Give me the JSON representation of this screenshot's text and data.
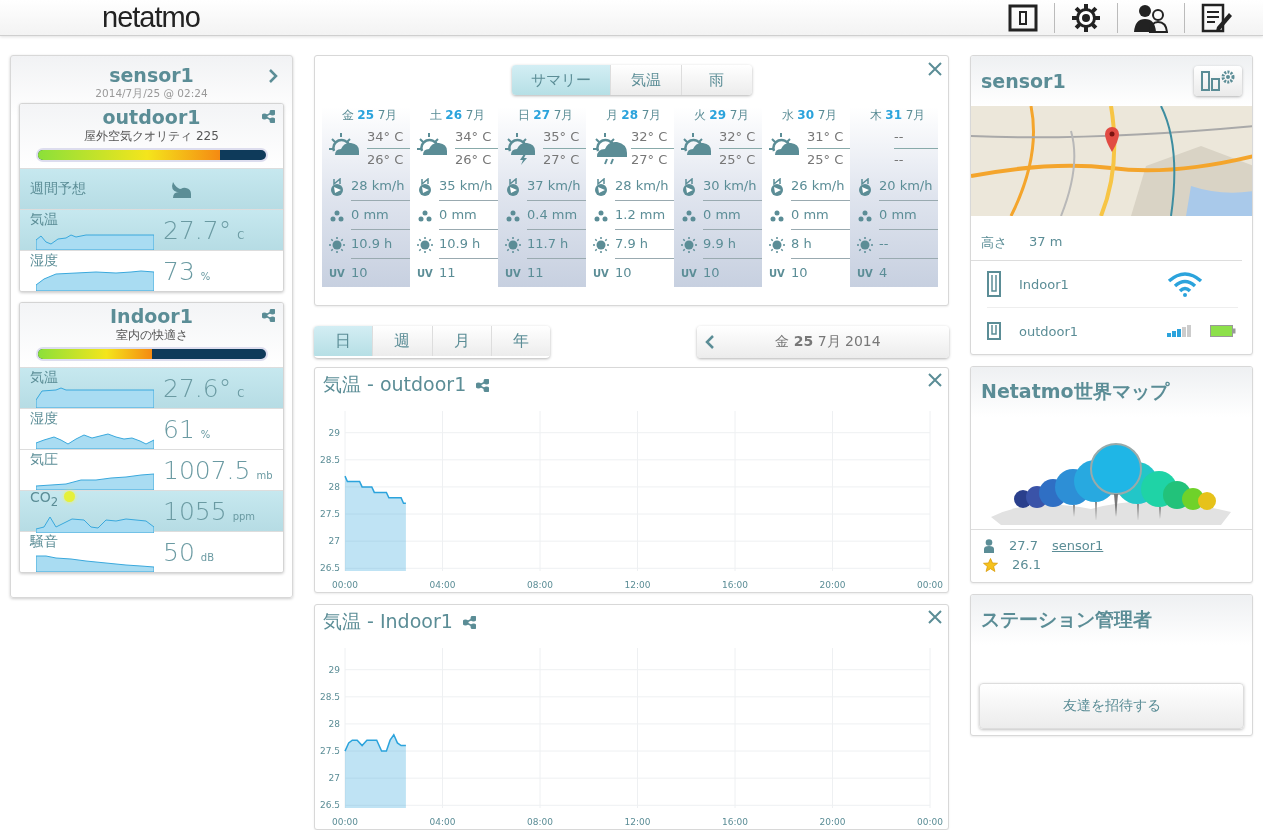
{
  "header": {
    "logo": "net**atmo**"
  },
  "station": {
    "title": "sensor1",
    "updated": "2014/7月/25 @ 02:24",
    "modules": [
      {
        "name": "outdoor1",
        "quality": "屋外空気クオリティ 225",
        "level": 0.8,
        "rows": [
          {
            "kind": "forecast",
            "label": "週間予想",
            "highlighted": true
          },
          {
            "kind": "measure",
            "label": "気温",
            "value": "27.7°",
            "unit": "C",
            "highlighted": true,
            "alert": false
          },
          {
            "kind": "measure",
            "label": "湿度",
            "value": "73",
            "unit": "%",
            "highlighted": false,
            "alert": false
          }
        ]
      },
      {
        "name": "Indoor1",
        "quality": "室内の快適さ",
        "level": 0.5,
        "rows": [
          {
            "kind": "measure",
            "label": "気温",
            "value": "27.6°",
            "unit": "C",
            "highlighted": true,
            "alert": false
          },
          {
            "kind": "measure",
            "label": "湿度",
            "value": "61",
            "unit": "%",
            "highlighted": false,
            "alert": false
          },
          {
            "kind": "measure",
            "label": "気圧",
            "value": "1007.5",
            "unit": "mb",
            "highlighted": false,
            "alert": false
          },
          {
            "kind": "measure",
            "label": "CO$_{2}$",
            "value": "1055",
            "unit": "ppm",
            "highlighted": true,
            "alert": true
          },
          {
            "kind": "measure",
            "label": "騒音",
            "value": "50",
            "unit": "dB",
            "highlighted": false,
            "alert": false
          }
        ]
      }
    ]
  },
  "forecast": {
    "tabs": [
      {
        "label": "サマリー",
        "selected": true
      },
      {
        "label": "気温",
        "selected": false
      },
      {
        "label": "雨",
        "selected": false
      }
    ],
    "days": [
      {
        "weekday": "金",
        "date": "25",
        "month": "7月",
        "kind": "sun-cloud",
        "high": "34° C",
        "low": "26° C",
        "wind": "28 km/h",
        "rain": "0 mm",
        "sun": "10.9 h",
        "uv_label": "UV",
        "uv": "10"
      },
      {
        "weekday": "土",
        "date": "26",
        "month": "7月",
        "kind": "sun-cloud",
        "high": "34° C",
        "low": "26° C",
        "wind": "35 km/h",
        "rain": "0 mm",
        "sun": "10.9 h",
        "uv_label": "UV",
        "uv": "11"
      },
      {
        "weekday": "日",
        "date": "27",
        "month": "7月",
        "kind": "storm",
        "high": "35° C",
        "low": "27° C",
        "wind": "37 km/h",
        "rain": "0.4 mm",
        "sun": "11.7 h",
        "uv_label": "UV",
        "uv": "11"
      },
      {
        "weekday": "月",
        "date": "28",
        "month": "7月",
        "kind": "rain",
        "high": "32° C",
        "low": "27° C",
        "wind": "28 km/h",
        "rain": "1.2 mm",
        "sun": "7.9 h",
        "uv_label": "UV",
        "uv": "10"
      },
      {
        "weekday": "火",
        "date": "29",
        "month": "7月",
        "kind": "sun-cloud",
        "high": "32° C",
        "low": "25° C",
        "wind": "30 km/h",
        "rain": "0 mm",
        "sun": "9.9 h",
        "uv_label": "UV",
        "uv": "10"
      },
      {
        "weekday": "水",
        "date": "30",
        "month": "7月",
        "kind": "sun-cloud",
        "high": "31° C",
        "low": "25° C",
        "wind": "26 km/h",
        "rain": "0 mm",
        "sun": "8 h",
        "uv_label": "UV",
        "uv": "10"
      },
      {
        "weekday": "木",
        "date": "31",
        "month": "7月",
        "kind": "none",
        "high": "--",
        "low": "--",
        "wind": "20 km/h",
        "rain": "0 mm",
        "sun": "--",
        "uv_label": "UV",
        "uv": "4"
      }
    ]
  },
  "period": {
    "tabs": [
      {
        "label": "日",
        "selected": true
      },
      {
        "label": "週",
        "selected": false
      },
      {
        "label": "月",
        "selected": false
      },
      {
        "label": "年",
        "selected": false
      }
    ],
    "date": "金 **25** 7月 2014"
  },
  "charts": [
    {
      "title": "気温 - outdoor1",
      "chart_data": {
        "type": "area",
        "x": [
          0,
          0.1,
          0.6,
          0.7,
          1.1,
          1.2,
          1.7,
          1.8,
          2.3,
          2.4,
          2.5
        ],
        "series": [
          {
            "color": "#2ba3dc",
            "values": [
              28.2,
              28.1,
              28.1,
              28.0,
              28.0,
              27.9,
              27.9,
              27.8,
              27.8,
              27.7,
              27.7
            ]
          }
        ],
        "xlim": [
          0,
          24
        ],
        "ylim": [
          26.45,
          29.4
        ],
        "xticks": [
          {
            "value": 0,
            "label": "00:00"
          },
          {
            "value": 4,
            "label": "04:00"
          },
          {
            "value": 8,
            "label": "08:00"
          },
          {
            "value": 12,
            "label": "12:00"
          },
          {
            "value": 16,
            "label": "16:00"
          },
          {
            "value": 20,
            "label": "20:00"
          },
          {
            "value": 24,
            "label": "00:00"
          }
        ],
        "yticks": [
          26.5,
          27,
          27.5,
          28,
          28.5,
          29
        ],
        "grid": true
      }
    },
    {
      "title": "気温 - Indoor1",
      "chart_data": {
        "type": "area",
        "x": [
          0,
          0.15,
          0.3,
          0.5,
          0.7,
          0.9,
          1.1,
          1.3,
          1.5,
          1.7,
          1.85,
          2.0,
          2.15,
          2.3,
          2.5
        ],
        "series": [
          {
            "color": "#2ba3dc",
            "values": [
              27.5,
              27.65,
              27.7,
              27.7,
              27.6,
              27.7,
              27.7,
              27.7,
              27.5,
              27.5,
              27.7,
              27.8,
              27.65,
              27.6,
              27.6
            ]
          }
        ],
        "xlim": [
          0,
          24
        ],
        "ylim": [
          26.45,
          29.4
        ],
        "xticks": [
          {
            "value": 0,
            "label": "00:00"
          },
          {
            "value": 4,
            "label": "04:00"
          },
          {
            "value": 8,
            "label": "08:00"
          },
          {
            "value": 12,
            "label": "12:00"
          },
          {
            "value": 16,
            "label": "16:00"
          },
          {
            "value": 20,
            "label": "20:00"
          },
          {
            "value": 24,
            "label": "00:00"
          }
        ],
        "yticks": [
          26.5,
          27,
          27.5,
          28,
          28.5,
          29
        ],
        "grid": true
      }
    }
  ],
  "device": {
    "title": "sensor1",
    "altitude_label": "高さ",
    "altitude": "37 m",
    "modules": [
      {
        "name": "Indoor1",
        "kind": "indoor"
      },
      {
        "name": "outdoor1",
        "kind": "outdoor"
      }
    ]
  },
  "weathermap": {
    "title": "Netatmo世界マップ",
    "rows": [
      {
        "kind": "person",
        "value": "27.7",
        "link": "sensor1"
      },
      {
        "kind": "star",
        "value": "26.1"
      }
    ]
  },
  "admin": {
    "title": "ステーション管理者",
    "button": "友達を招待する"
  }
}
